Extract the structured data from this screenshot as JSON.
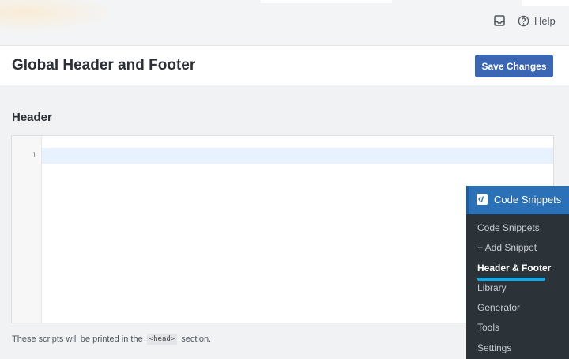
{
  "topbar": {
    "inbox_icon": "inbox-icon",
    "help_icon": "question-circle-icon",
    "help_label": "Help"
  },
  "page": {
    "title": "Global Header and Footer",
    "save_label": "Save Changes"
  },
  "section": {
    "title": "Header",
    "editor": {
      "line_numbers": [
        "1"
      ],
      "content": ""
    },
    "help_prefix": "These scripts will be printed in the",
    "help_code": "<head>",
    "help_suffix": "section."
  },
  "admin_menu": {
    "title": "Code Snippets",
    "icon": "code-snippets-logo-icon",
    "items": [
      {
        "label": "Code Snippets"
      },
      {
        "label": "+ Add Snippet"
      },
      {
        "label": "Header & Footer",
        "active": true
      },
      {
        "label": "Library"
      },
      {
        "label": "Generator"
      },
      {
        "label": "Tools"
      },
      {
        "label": "Settings"
      }
    ]
  },
  "colors": {
    "accent": "#3a66b3",
    "menu_bg": "#2c3338",
    "menu_header": "#2a71b8",
    "active_underline": "#11a9e6"
  }
}
